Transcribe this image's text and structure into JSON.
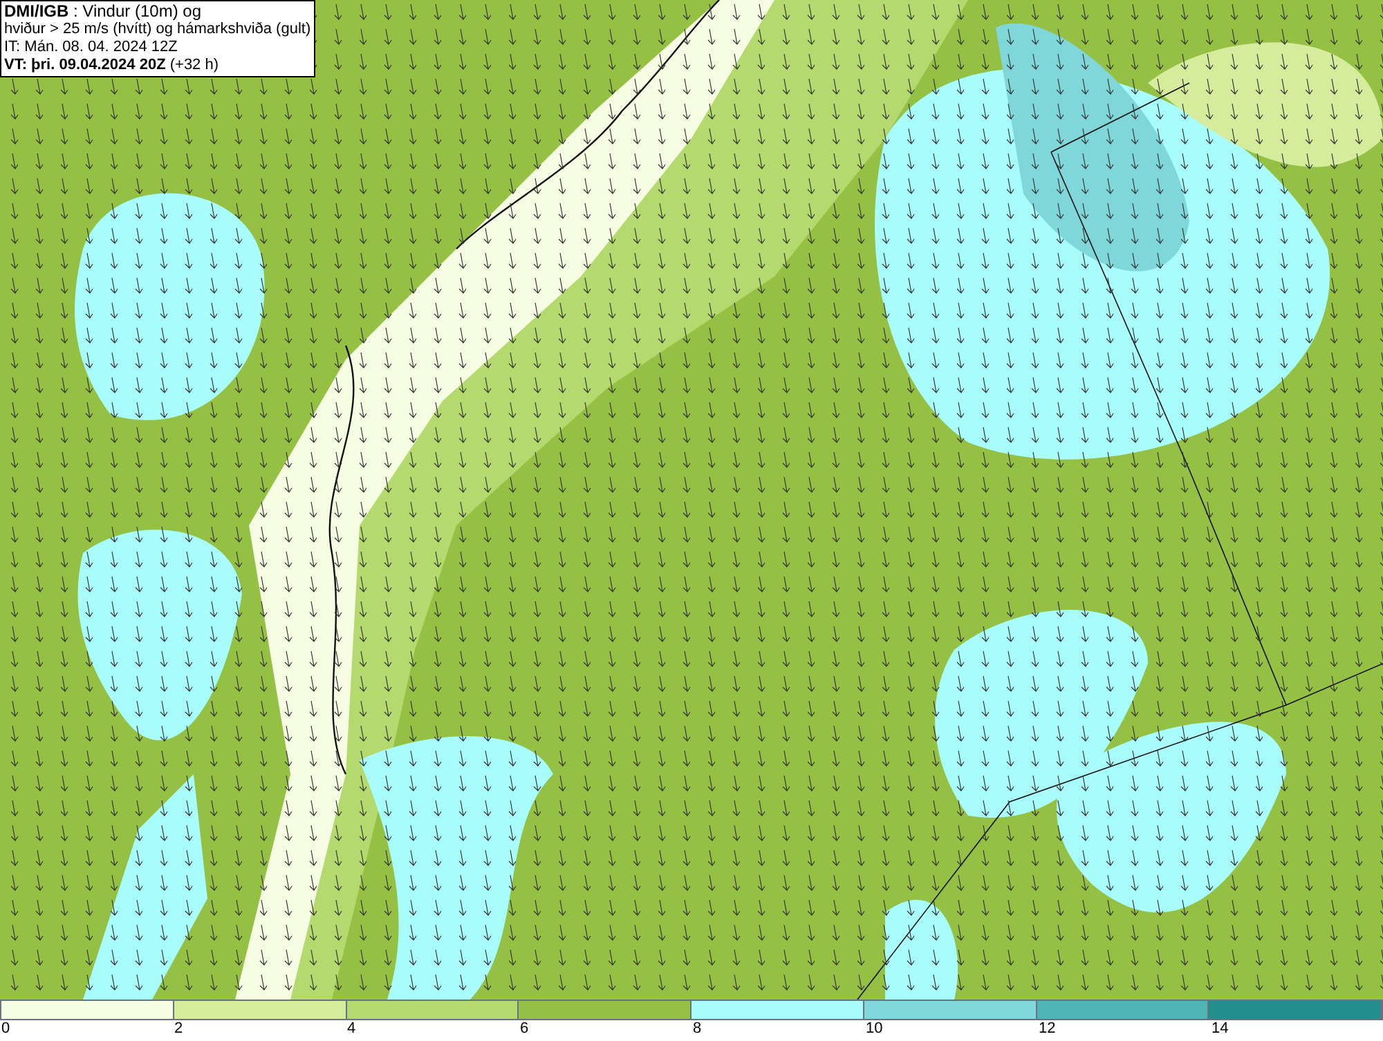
{
  "header": {
    "lines": [
      "**DMI/IGB** : Vindur (10m) og",
      "hviður > 25 m/s (hvítt) og hámarkshviða (gult)",
      "IT: Mán. 08. 04. 2024 12Z",
      "**VT: þri. 09.04.2024 20Z** (+32 h)"
    ]
  },
  "legend": {
    "bins": [
      {
        "color": "#f6fde2"
      },
      {
        "color": "#d4ec9c"
      },
      {
        "color": "#b4d96e"
      },
      {
        "color": "#94c044"
      },
      {
        "color": "#a8fcfc"
      },
      {
        "color": "#7fd7d9"
      },
      {
        "color": "#50b3b5"
      },
      {
        "color": "#238f8c"
      }
    ],
    "ticks": [
      "0",
      "2",
      "4",
      "6",
      "8",
      "10",
      "12",
      "14"
    ]
  }
}
